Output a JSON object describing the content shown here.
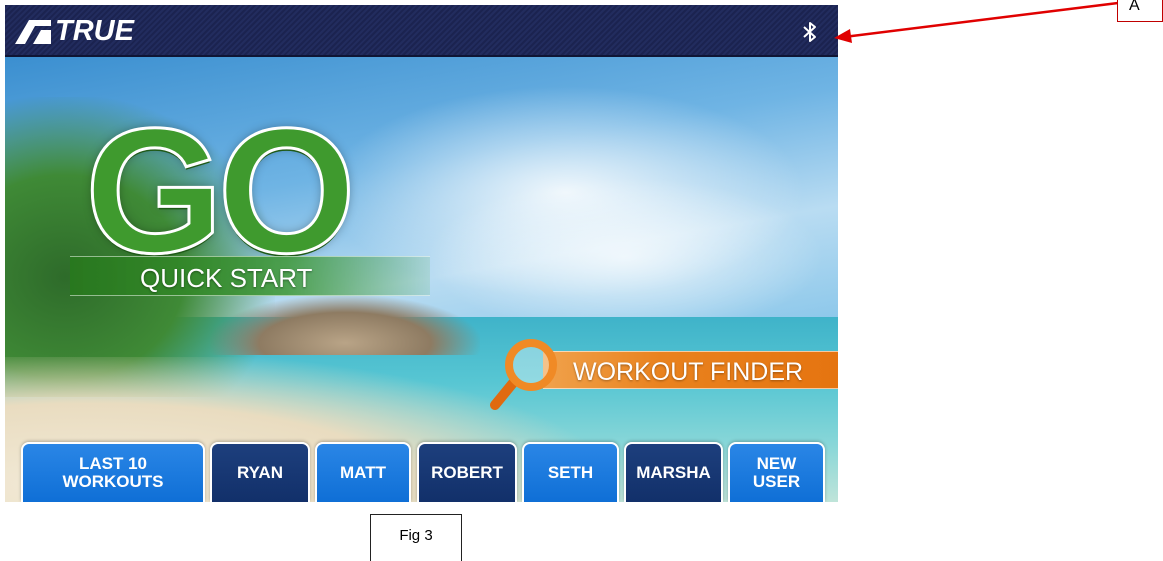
{
  "document": {
    "figure_caption": "Fig 3",
    "annotation_label": "A"
  },
  "header": {
    "brand": "TRUE",
    "bluetooth_icon": "bluetooth-icon"
  },
  "main": {
    "go_label": "GO",
    "quick_start_label": "QUICK START",
    "workout_finder_label": "WORKOUT FINDER",
    "magnifier_icon": "magnifier-icon"
  },
  "user_buttons": [
    {
      "label": "LAST 10\nWORKOUTS",
      "style": "light"
    },
    {
      "label": "RYAN",
      "style": "dark"
    },
    {
      "label": "MATT",
      "style": "light"
    },
    {
      "label": "ROBERT",
      "style": "dark"
    },
    {
      "label": "SETH",
      "style": "light"
    },
    {
      "label": "MARSHA",
      "style": "dark"
    },
    {
      "label": "NEW\nUSER",
      "style": "light"
    }
  ],
  "colors": {
    "header_bg": "#1b2350",
    "button_light": "#0f6fd6",
    "button_dark": "#12306a",
    "go_green": "#3f9a2e",
    "finder_orange": "#e57410",
    "annotation_red": "#c00000"
  }
}
